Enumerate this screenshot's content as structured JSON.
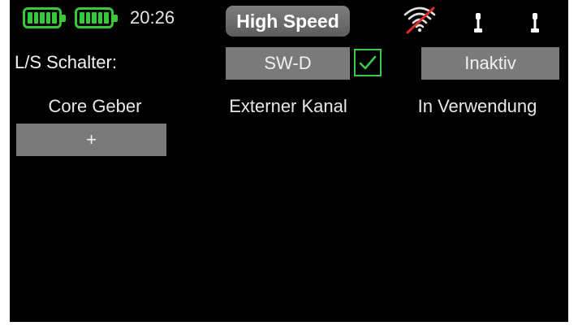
{
  "status_bar": {
    "battery_1_icon": "battery-full-icon",
    "battery_2_icon": "battery-full-icon",
    "time": "20:26",
    "mode": "High Speed",
    "signal_icon": "signal-off-icon",
    "antenna_icon": "antenna-icon",
    "battery_color": "#38c83a"
  },
  "switch_row": {
    "label": "L/S Schalter:",
    "switch_value": "SW-D",
    "checkbox_checked": true,
    "status_value": "Inaktiv"
  },
  "table": {
    "headers": [
      "Core Geber",
      "Externer Kanal",
      "In Verwendung"
    ],
    "add_label": "+"
  }
}
